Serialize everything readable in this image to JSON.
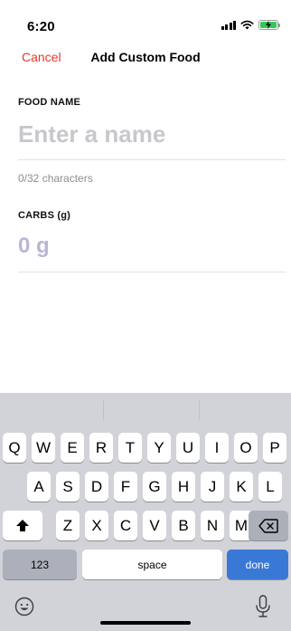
{
  "status_bar": {
    "time": "6:20",
    "signal_icon": "signal-bars-icon",
    "wifi_icon": "wifi-icon",
    "battery_icon": "battery-charging-icon",
    "battery_color": "#34c759"
  },
  "nav": {
    "cancel_label": "Cancel",
    "title": "Add Custom Food",
    "accent_color": "#e23a2a"
  },
  "food_name": {
    "label": "FOOD NAME",
    "value": "",
    "placeholder": "Enter a name",
    "char_count": "0/32 characters"
  },
  "carbs": {
    "label": "CARBS (g)",
    "value": "",
    "placeholder": "0 g"
  },
  "keyboard": {
    "row1": [
      "Q",
      "W",
      "E",
      "R",
      "T",
      "Y",
      "U",
      "I",
      "O",
      "P"
    ],
    "row2": [
      "A",
      "S",
      "D",
      "F",
      "G",
      "H",
      "J",
      "K",
      "L"
    ],
    "row3": [
      "Z",
      "X",
      "C",
      "V",
      "B",
      "N",
      "M"
    ],
    "numbers_label": "123",
    "space_label": "space",
    "done_label": "done",
    "shift_icon": "shift-icon",
    "backspace_icon": "backspace-icon",
    "emoji_icon": "emoji-icon",
    "mic_icon": "microphone-icon",
    "done_color": "#3a78d6"
  }
}
